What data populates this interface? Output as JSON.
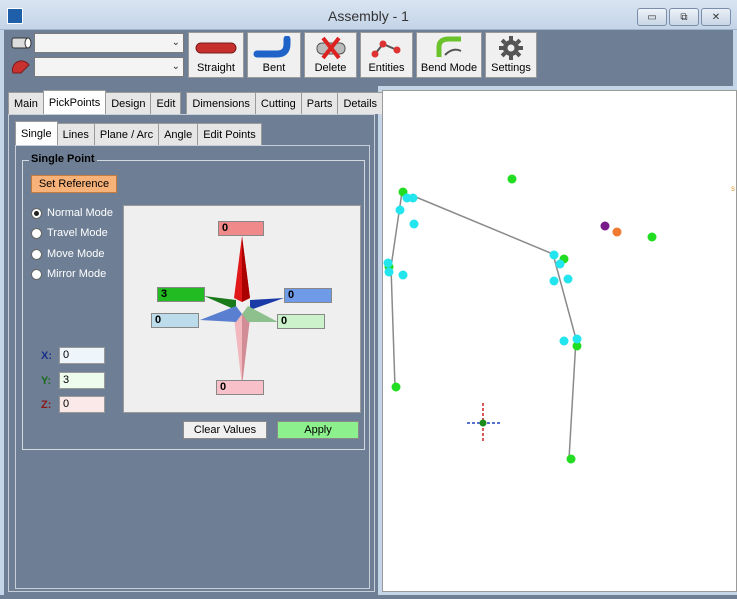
{
  "window": {
    "title": "Assembly - 1",
    "controls": {
      "minimize": "▭",
      "maximize": "⧉",
      "close": "✕"
    }
  },
  "toolbar": {
    "combos": [
      {
        "icon": "pipe-icon",
        "value": ""
      },
      {
        "icon": "bend-die-icon",
        "value": ""
      }
    ],
    "buttons": [
      {
        "id": "straight",
        "label": "Straight",
        "icon": "straight-pipe-icon"
      },
      {
        "id": "bent",
        "label": "Bent",
        "icon": "bent-pipe-icon"
      },
      {
        "id": "delete",
        "label": "Delete",
        "icon": "delete-pipe-icon"
      },
      {
        "id": "entities",
        "label": "Entities",
        "icon": "entities-icon"
      },
      {
        "id": "bendmode",
        "label": "Bend Mode",
        "icon": "bend-mode-icon"
      },
      {
        "id": "settings",
        "label": "Settings",
        "icon": "gear-icon"
      }
    ]
  },
  "main_tabs": [
    "Main",
    "PickPoints",
    "Design",
    "Edit",
    "Dimensions",
    "Cutting",
    "Parts",
    "Details"
  ],
  "main_tabs_active": "PickPoints",
  "sub_tabs": [
    "Single",
    "Lines",
    "Plane / Arc",
    "Angle",
    "Edit Points"
  ],
  "sub_tabs_active": "Single",
  "single_point": {
    "group_title": "Single Point",
    "set_reference": "Set Reference",
    "modes": [
      "Normal Mode",
      "Travel Mode",
      "Move Mode",
      "Mirror Mode"
    ],
    "selected_mode": "Normal Mode",
    "compass_values": {
      "top": "0",
      "left": "3",
      "right": "0",
      "front_left": "0",
      "front_right": "0",
      "bottom": "0"
    },
    "coords": {
      "x_label": "X:",
      "x": "0",
      "y_label": "Y:",
      "y": "3",
      "z_label": "Z:",
      "z": "0"
    },
    "clear_values": "Clear Values",
    "apply": "Apply"
  },
  "viewport": {
    "edge_text": "s",
    "colors": {
      "green": "#22dd22",
      "cyan": "#22e5ee",
      "purple": "#7a1a8a",
      "orange": "#f07a30",
      "line": "#8a8a8a"
    }
  }
}
